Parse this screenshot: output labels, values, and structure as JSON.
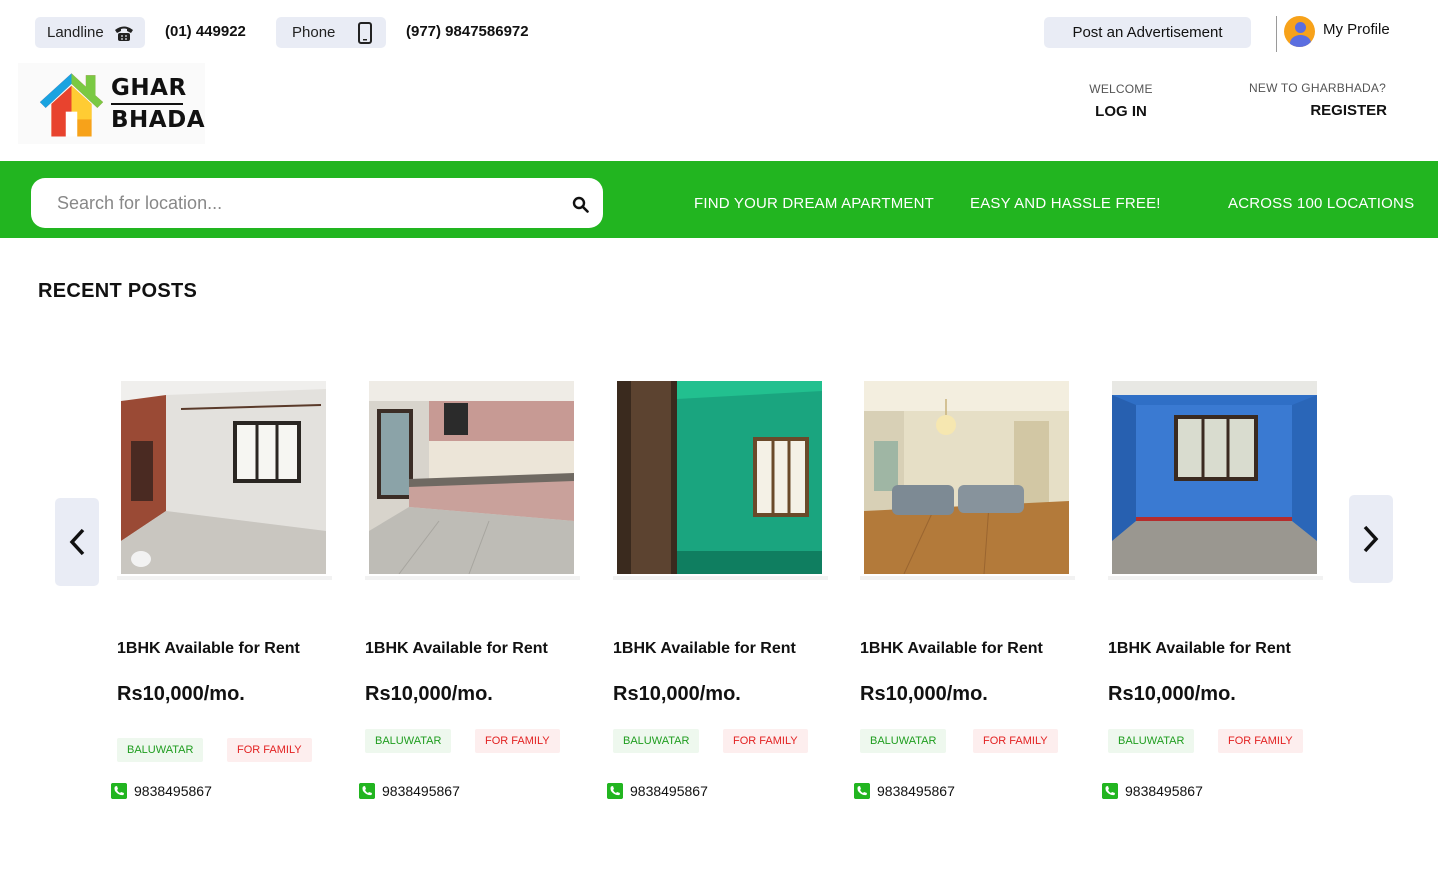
{
  "header": {
    "landline_label": "Landline",
    "landline_number": "(01) 449922",
    "phone_label": "Phone",
    "phone_number": "(977) 9847586972",
    "post_ad_label": "Post an Advertisement",
    "profile_label": "My Profile"
  },
  "brand": {
    "line1": "GHAR",
    "line2": "BHADA"
  },
  "auth": {
    "welcome_caption": "WELCOME",
    "login_label": "LOG IN",
    "register_caption": "NEW TO GHARBHADA?",
    "register_label": "REGISTER"
  },
  "band": {
    "search_placeholder": "Search for location...",
    "tagline1": "FIND YOUR DREAM APARTMENT",
    "tagline2": "EASY AND HASSLE FREE!",
    "tagline3": "ACROSS 100 LOCATIONS",
    "color": "#22b520"
  },
  "recent": {
    "title": "RECENT POSTS",
    "posts": [
      {
        "title": "1BHK Available for Rent",
        "price": "Rs10,000/mo.",
        "location": "BALUWATAR",
        "type": "FOR FAMILY",
        "phone": "9838495867",
        "photo": "room-brick-wall"
      },
      {
        "title": "1BHK Available for Rent",
        "price": "Rs10,000/mo.",
        "location": "BALUWATAR",
        "type": "FOR FAMILY",
        "phone": "9838495867",
        "photo": "kitchen"
      },
      {
        "title": "1BHK Available for Rent",
        "price": "Rs10,000/mo.",
        "location": "BALUWATAR",
        "type": "FOR FAMILY",
        "phone": "9838495867",
        "photo": "green-room"
      },
      {
        "title": "1BHK Available for Rent",
        "price": "Rs10,000/mo.",
        "location": "BALUWATAR",
        "type": "FOR FAMILY",
        "phone": "9838495867",
        "photo": "living-room-sofa"
      },
      {
        "title": "1BHK Available for Rent",
        "price": "Rs10,000/mo.",
        "location": "BALUWATAR",
        "type": "FOR FAMILY",
        "phone": "9838495867",
        "photo": "blue-room"
      }
    ]
  },
  "icons": [
    "landline-icon",
    "mobile-phone-icon",
    "avatar",
    "search-icon",
    "chevron-left-icon",
    "chevron-right-icon",
    "phone-icon"
  ],
  "colors": {
    "accent": "#22b520",
    "chip_location": "#1f9d1f",
    "chip_type": "#e22222",
    "pill_bg": "#e9ecf5"
  }
}
